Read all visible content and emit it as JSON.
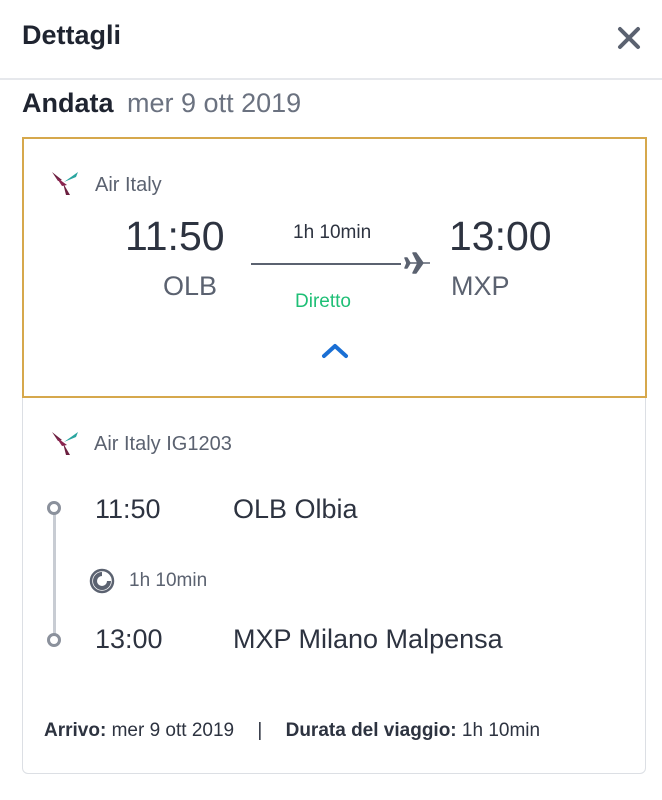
{
  "header": {
    "title": "Dettagli",
    "close_icon": "close-icon"
  },
  "section": {
    "direction": "Andata",
    "date": "mer 9 ott 2019"
  },
  "summary": {
    "airline": "Air Italy",
    "dep_time": "11:50",
    "dep_code": "OLB",
    "arr_time": "13:00",
    "arr_code": "MXP",
    "duration": "1h 10min",
    "stops": "Diretto",
    "accent_color": "#d6a84c",
    "stops_color": "#1fbf76",
    "chevron_color": "#1a6fd4"
  },
  "segment": {
    "airline_flight": "Air Italy IG1203",
    "dep_time": "11:50",
    "dep_place": "OLB Olbia",
    "duration": "1h 10min",
    "arr_time": "13:00",
    "arr_place": "MXP Milano Malpensa"
  },
  "footer": {
    "arrival_label": "Arrivo:",
    "arrival_value": "mer 9 ott 2019",
    "separator": "|",
    "duration_label": "Durata del viaggio:",
    "duration_value": "1h 10min"
  }
}
